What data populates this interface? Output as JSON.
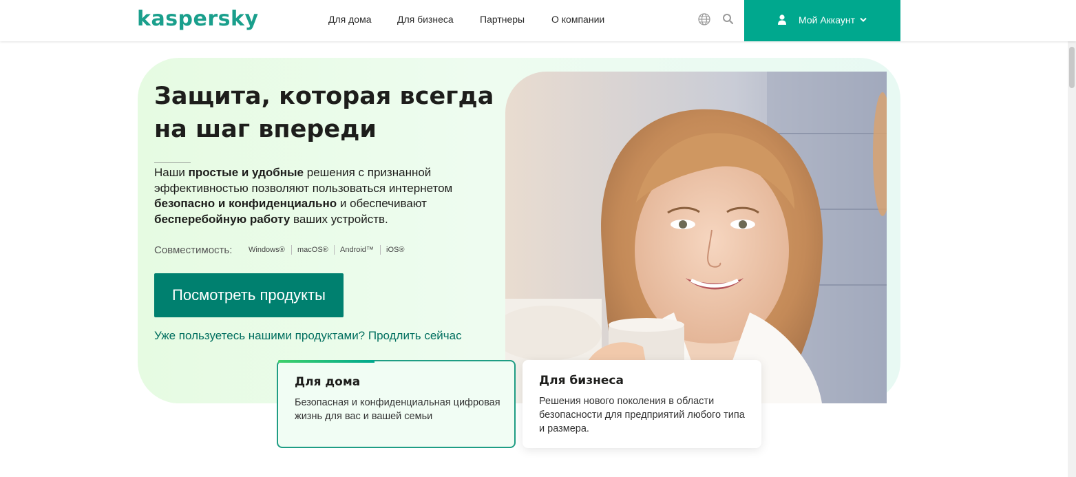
{
  "header": {
    "logo": "kaspersky",
    "nav": [
      "Для дома",
      "Для бизнеса",
      "Партнеры",
      "О компании"
    ],
    "account_label": "Мой Аккаунт",
    "icons": [
      "globe-icon",
      "search-icon",
      "user-icon",
      "chevron-down-icon"
    ]
  },
  "hero": {
    "title": "Защита, которая всегда на шаг впереди",
    "description": {
      "p1": "Наши ",
      "b1": "простые и удобные",
      "p2": " решения с признанной эффективностью позволяют пользоваться интернетом ",
      "b2": "безопасно и конфиденциально",
      "p3": " и обеспечивают ",
      "b3": "бесперебойную работу",
      "p4": " ваших устройств."
    },
    "compat_label": "Совместимость:",
    "platforms": [
      "Windows®",
      "macOS®",
      "Android™",
      "iOS®"
    ],
    "cta_label": "Посмотреть продукты",
    "renew_link": "Уже пользуетесь нашими продуктами? Продлить сейчас"
  },
  "cards": [
    {
      "title": "Для дома",
      "text": "Безопасная и конфиденциальная цифровая жизнь для вас и вашей семьи"
    },
    {
      "title": "Для бизнеса",
      "text": "Решения нового поколения в области безопасности для предприятий любого типа и размера."
    }
  ],
  "colors": {
    "brand": "#00a88e",
    "cta": "#00806f",
    "link": "#006f5f",
    "hero_bg": "#e8fbe6"
  }
}
